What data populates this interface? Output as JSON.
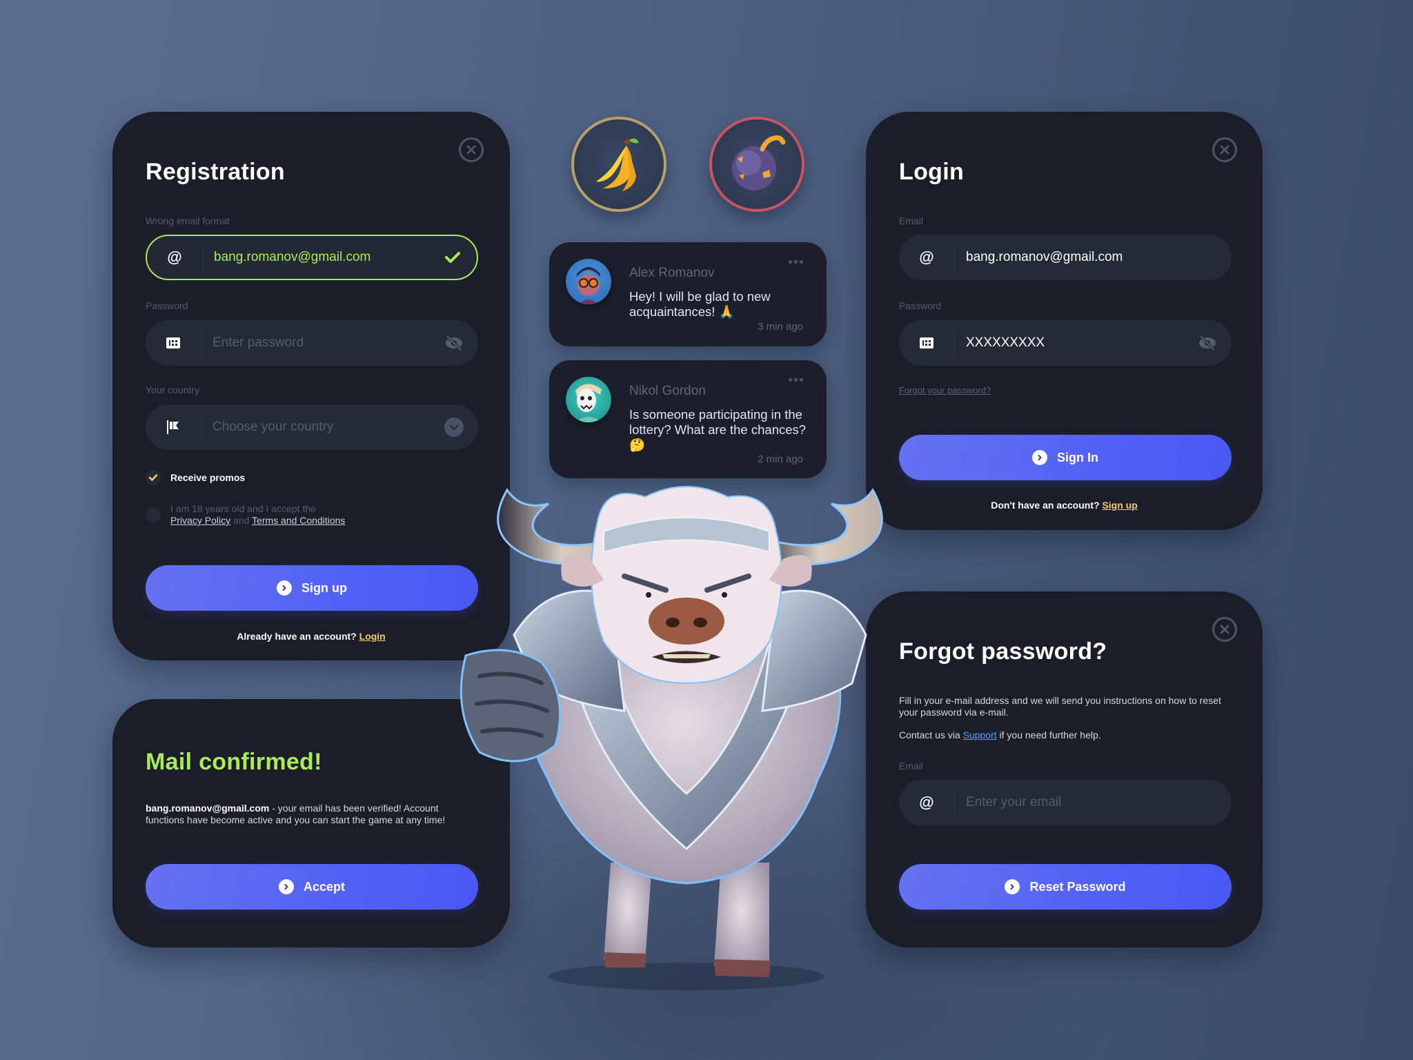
{
  "registration": {
    "title": "Registration",
    "email_label": "Wrong email format",
    "email_value": "bang.romanov@gmail.com",
    "email_icon": "at-icon",
    "email_status_icon": "check-icon",
    "password_label": "Password",
    "password_placeholder": "Enter password",
    "password_icon": "keypad-icon",
    "password_toggle_icon": "eye-off-icon",
    "country_label": "Your country",
    "country_placeholder": "Choose your country",
    "country_icon": "flag-icon",
    "country_dropdown_icon": "chevron-down-icon",
    "promos_label": "Receive promos",
    "promos_checked": true,
    "terms_prefix": "I am 18 years old and I accept the",
    "terms_privacy": "Privacy Policy",
    "terms_and": "and",
    "terms_conditions": "Terms and Conditions",
    "terms_checked": false,
    "submit_label": "Sign up",
    "footer_text": "Already have an account?",
    "footer_link": "Login"
  },
  "mail_confirmed": {
    "title": "Mail confirmed!",
    "email": "bang.romanov@gmail.com",
    "message": " - your email has been verified! Account functions have become active and you can start the game at any time!",
    "button_label": "Accept"
  },
  "tokens": [
    {
      "name": "banana",
      "ring": "gold"
    },
    {
      "name": "bomb",
      "ring": "red"
    }
  ],
  "chat": [
    {
      "name": "Alex Romanov",
      "message": "Hey! I will be glad to new acquaintances! 🙏",
      "time": "3 min ago"
    },
    {
      "name": "Nikol Gordon",
      "message": "Is someone participating in the lottery? What are the chances? 🤔",
      "time": "2 min ago"
    }
  ],
  "login": {
    "title": "Login",
    "email_label": "Email",
    "email_value": "bang.romanov@gmail.com",
    "password_label": "Password",
    "password_value": "XXXXXXXXX",
    "forgot_link": "Forgot your password?",
    "submit_label": "Sign In",
    "footer_text": "Don't have an account?",
    "footer_link": "Sign up"
  },
  "forgot": {
    "title": "Forgot password?",
    "description": "Fill in your e-mail address and we will send you instructions on how to reset your password via e-mail.",
    "contact_prefix": "Contact us via",
    "contact_link": "Support",
    "contact_suffix": "if you need further help.",
    "email_label": "Email",
    "email_placeholder": "Enter your email",
    "button_label": "Reset Password"
  },
  "colors": {
    "accent": "#5261f5",
    "valid": "#a9ec5a",
    "link": "#f2cf6b",
    "support_link": "#4aa3ff",
    "card": "#1b1e29"
  }
}
